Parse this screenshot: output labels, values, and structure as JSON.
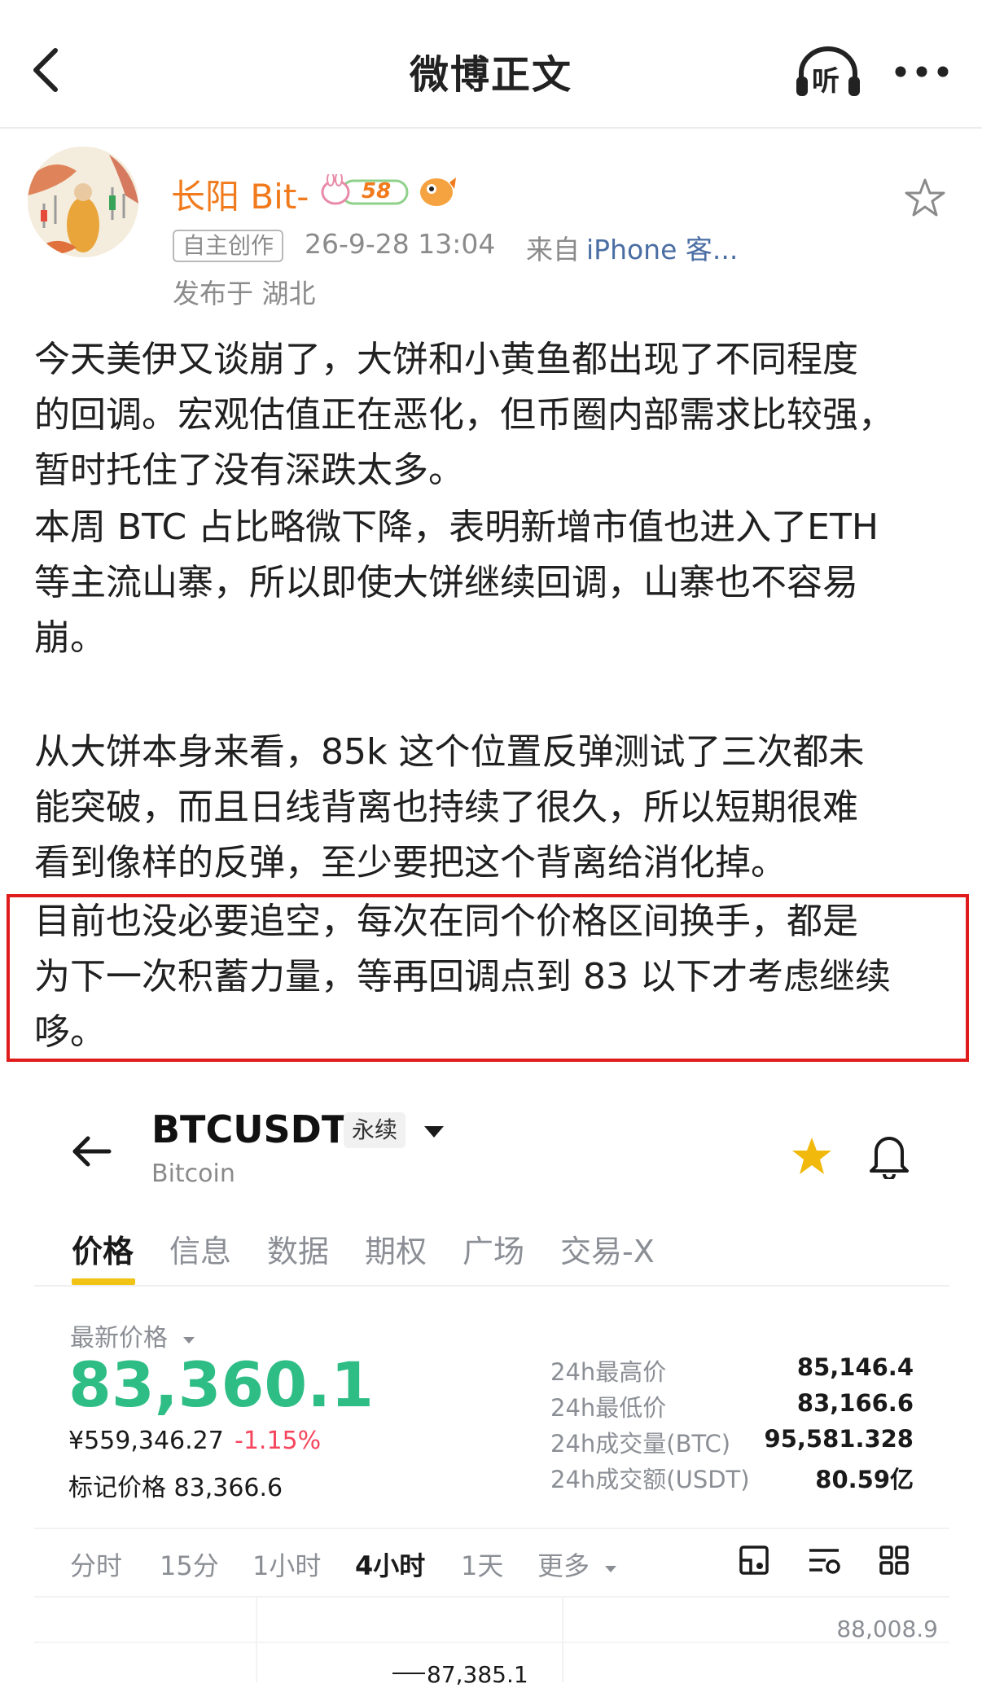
{
  "nav": {
    "title": "微博正文",
    "listen_label": "听"
  },
  "author": {
    "name": "长阳 Bit-",
    "level_badge": "58",
    "tag": "自主创作",
    "time": "26-9-28 13:04",
    "from_label": "来自",
    "device": "iPhone 客...",
    "location": "发布于 湖北"
  },
  "post": {
    "lines": [
      "今天美伊又谈崩了，大饼和小黄鱼都出现了不同程度",
      "的回调。宏观估值正在恶化，但币圈内部需求比较强，",
      "暂时托住了没有深跌太多。",
      "本周 BTC 占比略微下降，表明新增市值也进入了ETH",
      "等主流山寨，所以即使大饼继续回调，山寨也不容易",
      "崩。",
      "从大饼本身来看，85k 这个位置反弹测试了三次都未",
      "能突破，而且日线背离也持续了很久，所以短期很难",
      "看到像样的反弹，至少要把这个背离给消化掉。",
      "目前也没必要追空，每次在同个价格区间换手，都是",
      "为下一次积蓄力量，等再回调点到 83 以下才考虑继续",
      "哆。"
    ]
  },
  "card": {
    "symbol": "BTCUSDT",
    "contract_type": "永续",
    "name": "Bitcoin",
    "tabs": [
      "价格",
      "信息",
      "数据",
      "期权",
      "广场",
      "交易-X"
    ],
    "last_price_label": "最新价格",
    "last_price": "83,360.1",
    "cny_price": "¥559,346.27",
    "change_pct": "-1.15%",
    "mark_price": "标记价格 83,366.6",
    "stats": [
      {
        "label": "24h最高价",
        "value": "85,146.4"
      },
      {
        "label": "24h最低价",
        "value": "83,166.6"
      },
      {
        "label": "24h成交量(BTC)",
        "value": "95,581.328"
      },
      {
        "label": "24h成交额(USDT)",
        "value": "80.59亿"
      }
    ],
    "timeframes": [
      "分时",
      "15分",
      "1小时",
      "4小时",
      "1天",
      "更多"
    ],
    "active_timeframe_index": 3,
    "axis_top_value": "88,008.9",
    "high_marker": "87,385.1"
  },
  "colors": {
    "accent_orange": "#f07a1c",
    "up_green": "#2ebd85",
    "down_red": "#f6465d",
    "highlight_red": "#e01b1b",
    "tab_yellow": "#f0c315",
    "star_yellow": "#f0b90b"
  }
}
